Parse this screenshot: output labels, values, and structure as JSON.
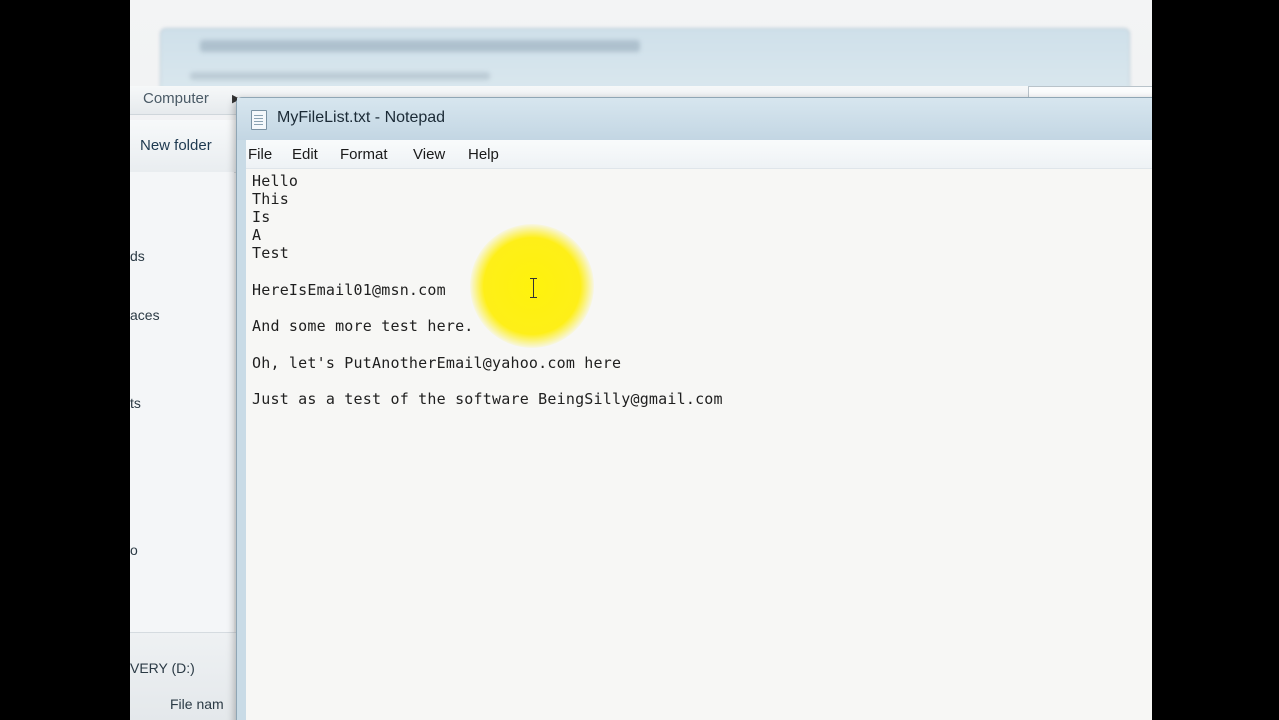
{
  "explorer": {
    "address_computer": "Computer",
    "new_folder_label": "New folder",
    "nav_fragments": [
      "ds",
      "aces",
      "ts",
      "o"
    ],
    "drive_label": "VERY (D:)",
    "file_name_label": "File nam"
  },
  "notepad": {
    "title": "MyFileList.txt - Notepad",
    "menu": [
      "File",
      "Edit",
      "Format",
      "View",
      "Help"
    ],
    "lines": [
      "Hello",
      "This",
      "Is",
      "A",
      "Test",
      "",
      "HereIsEmail01@msn.com",
      "",
      "And some more test here.",
      "",
      "Oh, let's PutAnotherEmail@yahoo.com here",
      "",
      "Just as a test of the software BeingSilly@gmail.com"
    ]
  },
  "colors": {
    "cursor_highlight": "#fff200",
    "notepad_frame": "#c9dbe6",
    "editor_background": "#f7f7f5"
  }
}
